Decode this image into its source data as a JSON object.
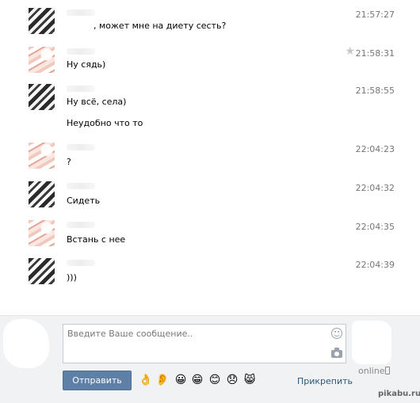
{
  "messages": [
    {
      "avatar": "dark",
      "text": ", может мне на диету сесть?",
      "time": "21:57:27",
      "starred": false
    },
    {
      "avatar": "pink",
      "text": "Ну сядь)",
      "time": "21:58:31",
      "starred": true
    },
    {
      "avatar": "dark",
      "text": "Ну всё, села)",
      "time": "21:58:55",
      "starred": false,
      "extra": "Неудобно что то"
    },
    {
      "avatar": "pink",
      "text": "?",
      "time": "22:04:23",
      "starred": false
    },
    {
      "avatar": "dark",
      "text": "Сидеть",
      "time": "22:04:32",
      "starred": false
    },
    {
      "avatar": "pink",
      "text": "Встань с нее",
      "time": "22:04:35",
      "starred": false
    },
    {
      "avatar": "dark",
      "text": ")))",
      "time": "22:04:39",
      "starred": false
    }
  ],
  "composer": {
    "placeholder": "Введите Ваше сообщение..",
    "send_label": "Отправить",
    "attach_label": "Прикрепить",
    "emoji_icons": [
      "ok-hand-icon",
      "ear-icon",
      "grin-icon",
      "big-grin-icon",
      "smile-icon",
      "sad-icon",
      "cat-smile-icon"
    ],
    "emoji_glyphs": [
      "👌",
      "👂",
      "😀",
      "😁",
      "😊",
      "😞",
      "😸"
    ]
  },
  "status": {
    "online_text": "online"
  },
  "watermark": "pikabu.ru"
}
